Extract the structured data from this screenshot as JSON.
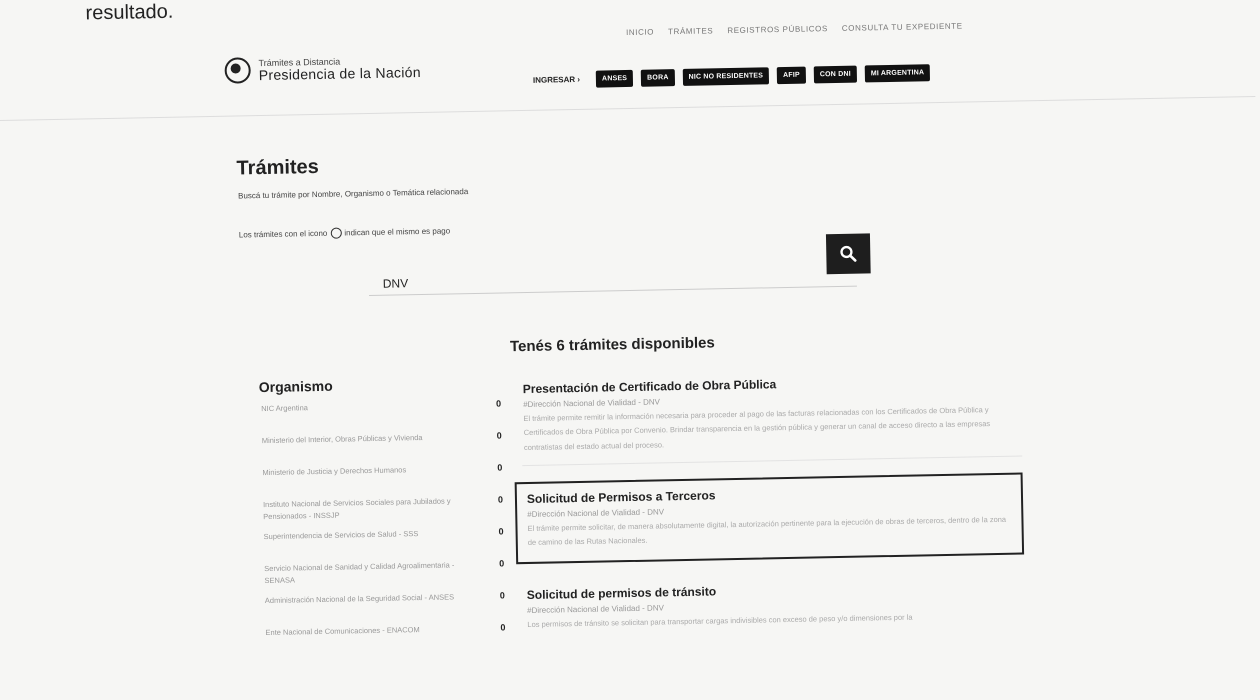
{
  "fragment": "resultado.",
  "header": {
    "logo_line1": "Trámites a Distancia",
    "logo_line2": "Presidencia de la Nación",
    "nav": [
      "INICIO",
      "TRÁMITES",
      "REGISTROS PÚBLICOS",
      "CONSULTA TU EXPEDIENTE"
    ],
    "ingresar_label": "INGRESAR ›",
    "login_buttons": [
      "ANSES",
      "BORA",
      "NIC NO RESIDENTES",
      "AFIP",
      "CON DNI",
      "MI ARGENTINA"
    ]
  },
  "main": {
    "title": "Trámites",
    "subtitle": "Buscá tu trámite por Nombre, Organismo o Temática relacionada",
    "paid_note_before": "Los trámites con el icono",
    "paid_note_after": "indican que el mismo es pago",
    "search": {
      "value": "DNV",
      "placeholder": ""
    },
    "results_count": "Tenés 6 trámites disponibles"
  },
  "sidebar": {
    "title": "Organismo",
    "items": [
      {
        "name": "NIC Argentina",
        "count": "0"
      },
      {
        "name": "Ministerio del Interior, Obras Públicas y Vivienda",
        "count": "0"
      },
      {
        "name": "Ministerio de Justicia y Derechos Humanos",
        "count": "0"
      },
      {
        "name": "Instituto Nacional de Servicios Sociales para Jubilados y Pensionados - INSSJP",
        "count": "0"
      },
      {
        "name": "Superintendencia de Servicios de Salud - SSS",
        "count": "0"
      },
      {
        "name": "Servicio Nacional de Sanidad y Calidad Agroalimentaria - SENASA",
        "count": "0"
      },
      {
        "name": "Administración Nacional de la Seguridad Social - ANSES",
        "count": "0"
      },
      {
        "name": "Ente Nacional de Comunicaciones - ENACOM",
        "count": "0"
      }
    ]
  },
  "results": [
    {
      "title": "Presentación de Certificado de Obra Pública",
      "org": "#Dirección Nacional de Vialidad - DNV",
      "desc": "El trámite permite remitir la información necesaria para proceder al pago de las facturas relacionadas con los Certificados de Obra Pública y Certificados de Obra Pública por Convenio. Brindar transparencia en la gestión pública y generar un canal de acceso directo a las empresas contratistas del estado actual del proceso."
    },
    {
      "title": "Solicitud de Permisos a Terceros",
      "org": "#Dirección Nacional de Vialidad - DNV",
      "desc": "El trámite permite solicitar, de manera absolutamente digital, la autorización pertinente para la ejecución de obras de terceros, dentro de la zona de camino de las Rutas Nacionales."
    },
    {
      "title": "Solicitud de permisos de tránsito",
      "org": "#Dirección Nacional de Vialidad - DNV",
      "desc": "Los permisos de tránsito se solicitan para transportar cargas indivisibles con exceso de peso y/o dimensiones por la"
    }
  ]
}
